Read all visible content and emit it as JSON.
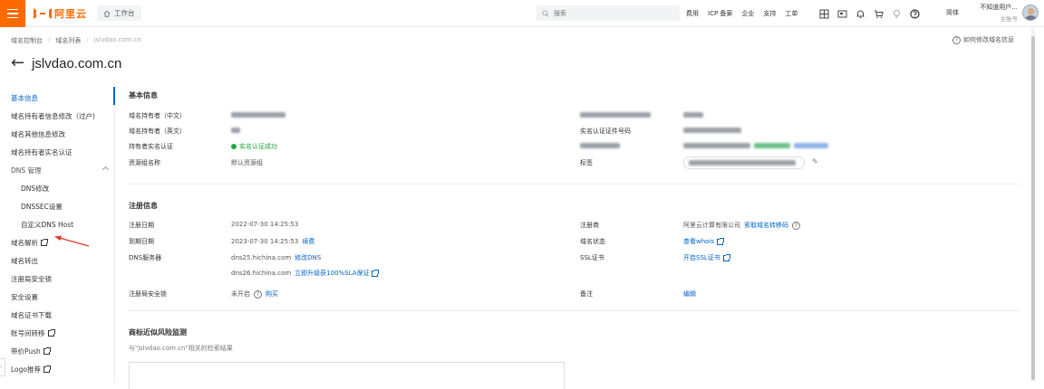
{
  "topbar": {
    "logo_text": "阿里云",
    "workbench_label": "工作台",
    "search_placeholder": "搜索",
    "links": [
      "费用",
      "ICP 备案",
      "企业",
      "支持",
      "工单"
    ],
    "lang": "简体",
    "user_name": "不知道用户...",
    "user_role": "主账号"
  },
  "breadcrumb": {
    "items": [
      "域名控制台",
      "域名列表",
      "jslvdao.com.cn"
    ]
  },
  "help_link": "如何修改域名信息",
  "page_title": "jslvdao.com.cn",
  "sidebar": {
    "items": [
      {
        "label": "基本信息"
      },
      {
        "label": "域名持有者信息修改（过户)"
      },
      {
        "label": "域名其他信息修改"
      },
      {
        "label": "域名持有者实名认证"
      },
      {
        "label": "DNS 管理"
      },
      {
        "label": "DNS修改"
      },
      {
        "label": "DNSSEC设置"
      },
      {
        "label": "自定义DNS Host"
      },
      {
        "label": "域名解析"
      },
      {
        "label": "域名转出"
      },
      {
        "label": "注册局安全锁"
      },
      {
        "label": "安全设置"
      },
      {
        "label": "域名证书下载"
      },
      {
        "label": "账号间转移"
      },
      {
        "label": "带价Push"
      },
      {
        "label": "Logo推荐"
      }
    ]
  },
  "basic": {
    "title": "基本信息",
    "owner_cn_label": "域名持有者（中文）",
    "owner_en_label": "域名持有者（英文）",
    "realname_label": "持有者实名认证",
    "realname_status": "实名认证成功",
    "resgroup_label": "资源组名称",
    "resgroup_value": "默认资源组",
    "cert_no_label": "实名认证证件号码",
    "tag_label": "标签"
  },
  "registration": {
    "title": "注册信息",
    "reg_date_label": "注册日期",
    "reg_date": "2022-07-30 14:25:53",
    "exp_date_label": "到期日期",
    "exp_date": "2023-07-30 14:25:53",
    "renew_link": "续费",
    "dns_label": "DNS服务器",
    "dns1": "dns25.hichina.com",
    "modify_dns": "修改DNS",
    "dns2": "dns26.hichina.com",
    "upgrade_sla": "立即升级获100%SLA保证",
    "lock_label": "注册局安全锁",
    "lock_status": "未开启",
    "buy_link": "购买",
    "registrar_label": "注册商",
    "registrar_value": "阿里云计算有限公司",
    "transfer_code_link": "索取域名转移码",
    "status_label": "域名状态",
    "whois_link": "查看whois",
    "ssl_label": "SSL证书",
    "ssl_link": "开启SSL证书",
    "remark_label": "备注",
    "edit_link": "编辑"
  },
  "trademark": {
    "title": "商标近似风险监测",
    "subtitle": "与\"jslvdao.com.cn\"相关的检索结果"
  },
  "colors": {
    "brand": "#ff6a00",
    "link": "#0064c8",
    "success": "#1e9f3c",
    "annotation": "#e03a2f"
  }
}
